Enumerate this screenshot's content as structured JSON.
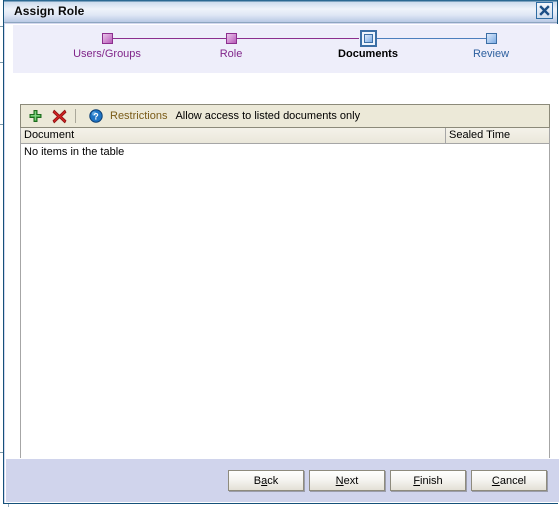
{
  "window": {
    "title": "Assign Role",
    "close_icon": "close-icon",
    "accent_title_bar": "#cddced",
    "dialog_border": "#15517a"
  },
  "stepper": {
    "steps": [
      {
        "label": "Users/Groups",
        "state": "done",
        "node_icon": "step-node-square",
        "color": "#81268a"
      },
      {
        "label": "Role",
        "state": "done",
        "node_icon": "step-node-square",
        "color": "#81268a"
      },
      {
        "label": "Documents",
        "state": "current",
        "node_icon": "step-node-square-selected",
        "color": "#000000"
      },
      {
        "label": "Review",
        "state": "todo",
        "node_icon": "step-node-square",
        "color": "#2c5f9e"
      }
    ],
    "connector_done_color": "#8c2f8e",
    "connector_todo_color": "#4d7fbd",
    "background": "#eeeefa"
  },
  "toolbar": {
    "add_icon": "plus-icon",
    "delete_icon": "delete-x-icon",
    "help_icon": "help-question-icon",
    "restrictions_label": "Restrictions",
    "restrictions_value": "Allow access to listed documents only",
    "background": "#ece9d8",
    "label_color": "#7a5c18"
  },
  "table": {
    "columns": [
      {
        "label": "Document"
      },
      {
        "label": "Sealed Time"
      }
    ],
    "rows": [],
    "empty_message": "No items in the table"
  },
  "buttons": {
    "back": {
      "pre": "B",
      "mnemonic": "a",
      "post": "ck"
    },
    "next": {
      "pre": "",
      "mnemonic": "N",
      "post": "ext"
    },
    "finish": {
      "pre": "",
      "mnemonic": "F",
      "post": "inish"
    },
    "cancel": {
      "pre": "",
      "mnemonic": "C",
      "post": "ancel"
    },
    "panel_background": "#d0d4ec"
  }
}
